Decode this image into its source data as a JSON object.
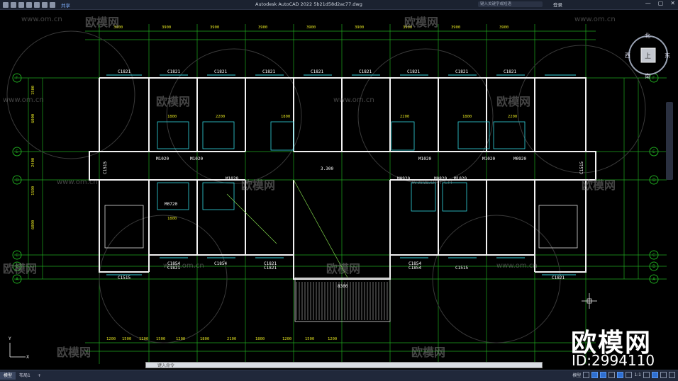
{
  "titlebar": {
    "app_title": "Autodesk AutoCAD 2022    5b21d58d2ac77.dwg",
    "share_label": "共享",
    "search_placeholder": "键入关键字或短语",
    "login_label": "登录"
  },
  "compass": {
    "north": "北",
    "south": "南",
    "east": "东",
    "west": "西",
    "top": "上"
  },
  "statusbar": {
    "tabs": [
      "模型",
      "布局1"
    ],
    "model_label": "模型",
    "scale": "1:1",
    "command_placeholder": "键入命令"
  },
  "watermark": {
    "brand": "欧模网",
    "url": "www.om.cn",
    "id": "ID:2994110"
  },
  "drawing": {
    "window_labels": [
      "C1821",
      "C1821",
      "C1821",
      "C1821",
      "C1821",
      "C1821",
      "C1821",
      "C1821",
      "C1821",
      "C1515",
      "C1854",
      "C1821",
      "C1854",
      "C1821",
      "C1821",
      "C1854",
      "C1854",
      "C1515",
      "C1821"
    ],
    "door_labels": [
      "M1020",
      "M1020",
      "M1020",
      "M1020",
      "M0920",
      "M1020",
      "M0720",
      "M0920",
      "M0820",
      "M1020"
    ],
    "elevation_label": "3.300",
    "axis_circle_left": [
      "F",
      "E",
      "D",
      "C",
      "B",
      "A"
    ],
    "axis_circle_right": [
      "F",
      "E",
      "D",
      "C",
      "B",
      "A"
    ],
    "dim_top": [
      "3900",
      "3900",
      "3900",
      "3900",
      "3900",
      "3900",
      "3900",
      "3900",
      "3900"
    ],
    "dim_bottom": [
      "1200",
      "1500",
      "1200",
      "1500",
      "1200",
      "1800",
      "2100",
      "1800",
      "1200",
      "1500",
      "1200"
    ],
    "dim_side": [
      "1500",
      "6000",
      "2400",
      "1500",
      "6000"
    ],
    "side_label_left": "C1515",
    "side_label_right": "C1515",
    "room_sizes": [
      "1800",
      "2200",
      "1800",
      "2200",
      "1800",
      "2200",
      "1800"
    ],
    "bottom_center": "8300"
  }
}
